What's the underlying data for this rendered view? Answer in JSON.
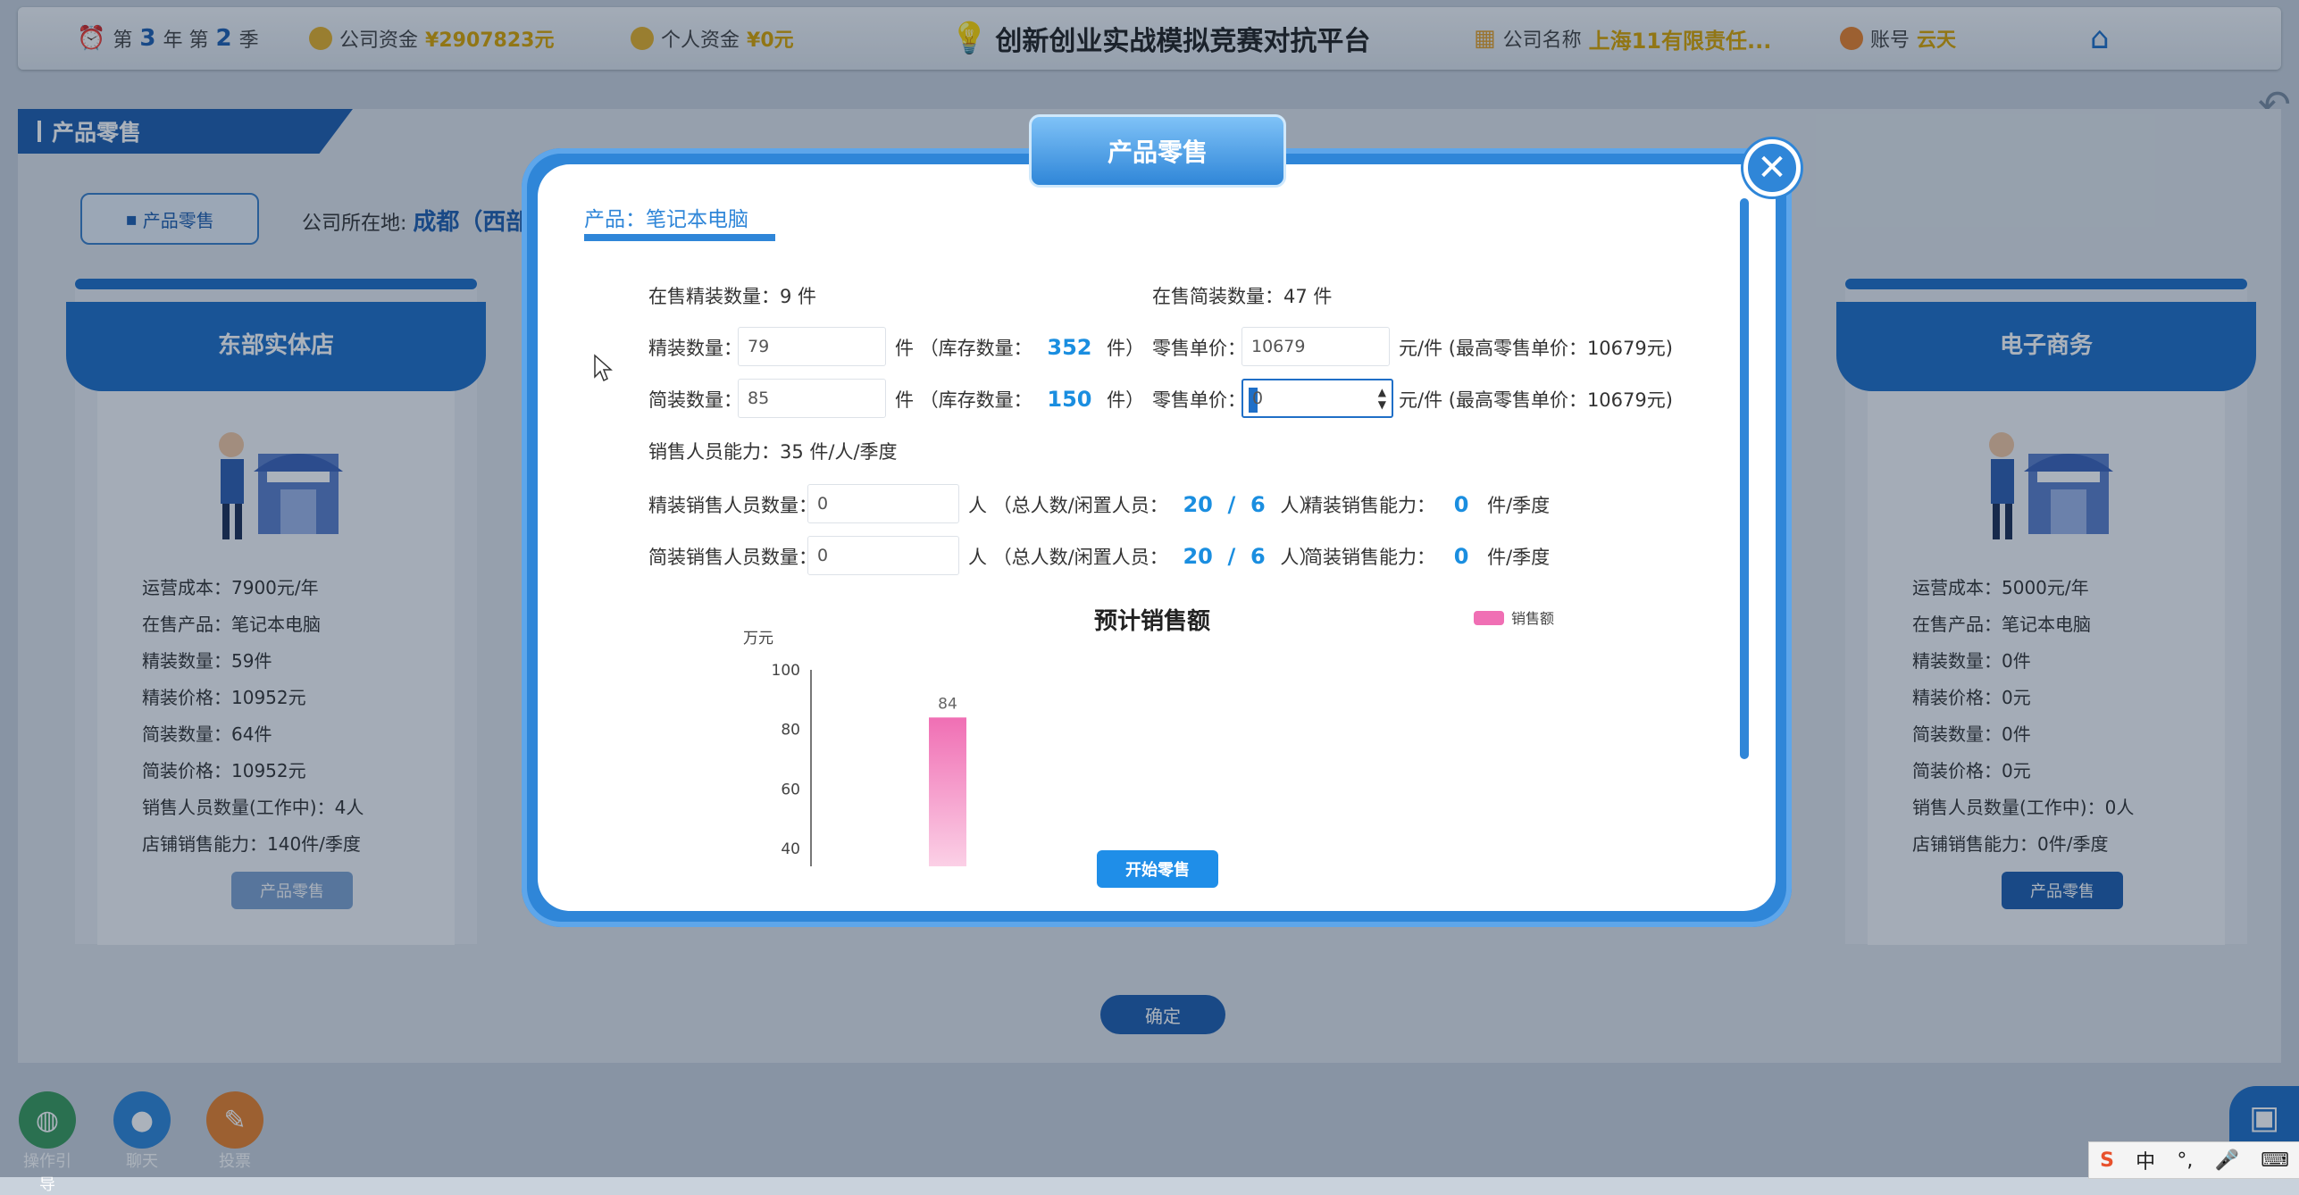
{
  "topbar": {
    "year_prefix": "第",
    "year": "3",
    "year_suffix": "年 第",
    "season": "2",
    "season_suffix": "季",
    "company_funds_label": "公司资金",
    "company_funds_value": "¥2907823元",
    "personal_funds_label": "个人资金",
    "personal_funds_value": "¥0元",
    "platform_title": "创新创业实战模拟竞赛对抗平台",
    "company_name_label": "公司名称",
    "company_name_value": "上海11有限责任...",
    "account_label": "账号",
    "account_value": "云天"
  },
  "page": {
    "section_title": "产品零售",
    "retail_tab": "产品零售",
    "location_label": "公司所在地:",
    "location_value": "成都（西部地",
    "confirm_label": "确定"
  },
  "stores": [
    {
      "name": "东部实体店",
      "lines": [
        "运营成本：7900元/年",
        "在售产品：笔记本电脑",
        "精装数量：59件",
        "精装价格：10952元",
        "简装数量：64件",
        "简装价格：10952元",
        "销售人员数量(工作中)：4人",
        "店铺销售能力：140件/季度"
      ],
      "button": "产品零售"
    },
    {
      "name": "电子商务",
      "lines": [
        "运营成本：5000元/年",
        "在售产品：笔记本电脑",
        "精装数量：0件",
        "精装价格：0元",
        "简装数量：0件",
        "简装价格：0元",
        "销售人员数量(工作中)：0人",
        "店铺销售能力：0件/季度"
      ],
      "button": "产品零售"
    }
  ],
  "tools": [
    {
      "label": "操作引导",
      "color": "#3a9a5b"
    },
    {
      "label": "聊天",
      "color": "#2f86d8"
    },
    {
      "label": "投票",
      "color": "#e8812c"
    }
  ],
  "ime": [
    "中",
    "°,",
    "🎤",
    "⌨"
  ],
  "modal": {
    "title": "产品零售",
    "product_tab": "产品：笔记本电脑",
    "on_sale_deluxe": "在售精装数量：9 件",
    "on_sale_simple": "在售简装数量：47 件",
    "deluxe_qty_label": "精装数量：",
    "deluxe_qty_value": "79",
    "deluxe_stock_prefix": "件 （库存数量：",
    "deluxe_stock": "352",
    "stock_suffix": "件）",
    "deluxe_price_label": "零售单价：",
    "deluxe_price_value": "10679",
    "deluxe_price_suffix": "元/件 (最高零售单价：10679元)",
    "simple_qty_label": "简装数量：",
    "simple_qty_value": "85",
    "simple_stock_prefix": "件 （库存数量：",
    "simple_stock": "150",
    "simple_price_label": "零售单价：",
    "simple_price_value": "0",
    "simple_price_suffix": "元/件 (最高零售单价：10679元)",
    "sales_capacity": "销售人员能力：35 件/人/季度",
    "deluxe_staff_label": "精装销售人员数量：",
    "deluxe_staff_value": "0",
    "staff_prefix": "人 （总人数/闲置人员：",
    "staff_total": "20",
    "staff_slash": "/",
    "staff_idle": "6",
    "staff_suffix": "人）",
    "deluxe_capacity_label": "精装销售能力：",
    "deluxe_capacity_value": "0",
    "capacity_suffix": "件/季度",
    "simple_staff_label": "简装销售人员数量：",
    "simple_staff_value": "0",
    "simple_capacity_label": "简装销售能力：",
    "simple_capacity_value": "0",
    "start_button": "开始零售"
  },
  "chart_data": {
    "type": "bar",
    "title": "预计销售额",
    "ylabel": "万元",
    "yticks": [
      "100",
      "80",
      "60",
      "40"
    ],
    "ylim": [
      40,
      100
    ],
    "series": [
      {
        "name": "销售额",
        "values": [
          84
        ]
      }
    ],
    "data_labels": [
      "84"
    ],
    "bar_color": "#f06fb4",
    "legend": "top-right"
  },
  "colors": {
    "primary": "#2f86d8",
    "dark_blue": "#1f5fae",
    "gold": "#d7a300",
    "number_blue": "#1a8ee0"
  }
}
